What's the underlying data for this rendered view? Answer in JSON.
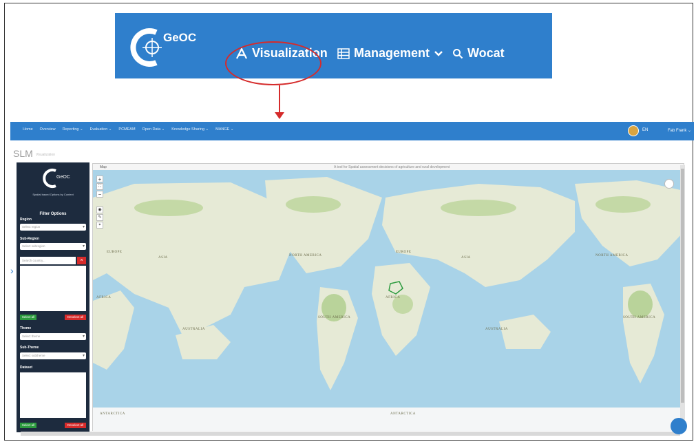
{
  "banner": {
    "logo_text": "GeOC",
    "nav": [
      {
        "label": "Visualization",
        "icon": "visualization-icon"
      },
      {
        "label": "Management",
        "icon": "management-icon"
      },
      {
        "label": "Wocat",
        "icon": "search-icon"
      }
    ]
  },
  "app": {
    "nav_items": [
      "Home",
      "Overview",
      "Reporting ⌄",
      "Evaluation ⌄",
      "PCMEAM",
      "Open Data ⌄",
      "Knowledge Sharing ⌄",
      "MANGE ⌄"
    ],
    "lang": "EN",
    "user": "Fab Frank ⌄",
    "page_title": "SLM",
    "page_subtitle": "Visualization"
  },
  "sidebar": {
    "logo_text": "GeOC",
    "tagline": "Spatial based Options by Context",
    "heading": "Filter Options",
    "region_label": "Region",
    "region_placeholder": "Select region",
    "subregion_label": "Sub-Region",
    "subregion_placeholder": "Select subregion",
    "search_placeholder": "Search country...",
    "select_all": "Select all",
    "deselect_all": "Deselect all",
    "theme_label": "Theme",
    "theme_placeholder": "Select theme",
    "subtheme_label": "Sub-Theme",
    "subtheme_placeholder": "Select subtheme",
    "dataset_label": "Dataset"
  },
  "map": {
    "panel_label": "Map",
    "panel_title": "A tool for Spatial assessment decisions of agriculture and rural development",
    "labels": [
      "EUROPE",
      "ASIA",
      "AFRICA",
      "NORTH AMERICA",
      "SOUTH AMERICA",
      "AUSTRALIA",
      "ANTARCTICA",
      "EUROPE",
      "ASIA",
      "AFRICA",
      "NORTH AMERICA",
      "SOUTH AMERICA",
      "AUSTRALIA",
      "ANTARCTICA"
    ]
  }
}
